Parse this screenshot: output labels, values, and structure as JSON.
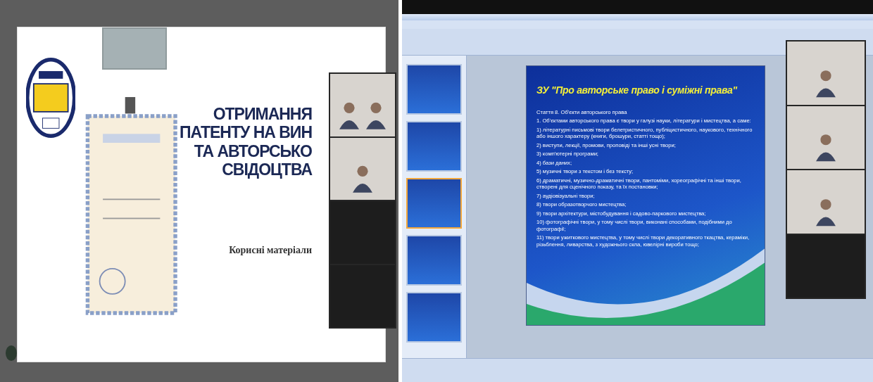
{
  "left_screen": {
    "slide": {
      "title_lines": [
        "ОТРИМАННЯ",
        "ПАТЕНТУ НА ВИН",
        "ТА АВТОРСЬКО",
        "СВІДОЦТВА"
      ],
      "subtitle": "Корисні матеріали"
    },
    "video_tiles": [
      {
        "kind": "camera_pair"
      },
      {
        "kind": "camera"
      },
      {
        "kind": "blank"
      },
      {
        "kind": "blank"
      }
    ]
  },
  "right_screen": {
    "thumbnails": [
      {
        "selected": false
      },
      {
        "selected": false
      },
      {
        "selected": true
      },
      {
        "selected": false
      },
      {
        "selected": false
      }
    ],
    "slide": {
      "title": "ЗУ \"Про авторське право і суміжні права\"",
      "heading": "Стаття 8. Об'єкти авторського права",
      "lines": [
        "1. Об'єктами авторського права є твори у галузі науки, літератури і мистецтва, а саме:",
        "1) літературні письмові твори белетристичного, публіцистичного, наукового, технічного або іншого характеру (книги, брошури, статті тощо);",
        "2) виступи, лекції, промови, проповіді та інші усні твори;",
        "3) комп'ютерні програми;",
        "4) бази даних;",
        "5) музичні твори з текстом і без тексту;",
        "6) драматичні, музично-драматичні твори, пантоміми, хореографічні та інші твори, створені для сценічного показу, та їх постановки;",
        "7) аудіовізуальні твори;",
        "8) твори образотворчого мистецтва;",
        "9) твори архітектури, містобудування і садово-паркового мистецтва;",
        "10) фотографічні твори, у тому числі твори, виконані способами, подібними до фотографії;",
        "11) твори ужиткового мистецтва, у тому числі твори декоративного ткацтва, кераміки, різьблення, ливарства, з художнього скла, ювелірні вироби тощо;"
      ]
    },
    "video_tiles": [
      {
        "kind": "camera"
      },
      {
        "kind": "camera"
      },
      {
        "kind": "camera"
      },
      {
        "kind": "blank"
      }
    ]
  }
}
